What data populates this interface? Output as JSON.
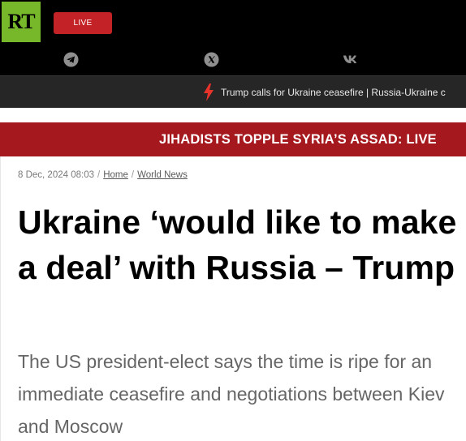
{
  "header": {
    "logo_text": "RT",
    "live_label": "LIVE",
    "social": [
      {
        "icon": "telegram-icon"
      },
      {
        "icon": "x-twitter-icon"
      },
      {
        "icon": "vk-icon"
      }
    ]
  },
  "ticker": {
    "icon": "lightning-bolt-icon",
    "text": "Trump calls for Ukraine ceasefire | Russia-Ukraine c"
  },
  "breaking_banner": {
    "text": "JIHADISTS TOPPLE SYRIA’S ASSAD: LIVE"
  },
  "article": {
    "date": "8 Dec, 2024 08:03",
    "breadcrumbs": [
      "Home",
      "World News"
    ],
    "headline": "Ukraine ‘would like to make a deal’ with Russia – Trump",
    "lede": "The US president-elect says the time is ripe for an immediate ceasefire and negotiations between Kiev and Moscow"
  },
  "colors": {
    "brand_green": "#77b82a",
    "live_red": "#c32326",
    "banner_red": "#a5181d",
    "bolt_red": "#e8332b"
  }
}
